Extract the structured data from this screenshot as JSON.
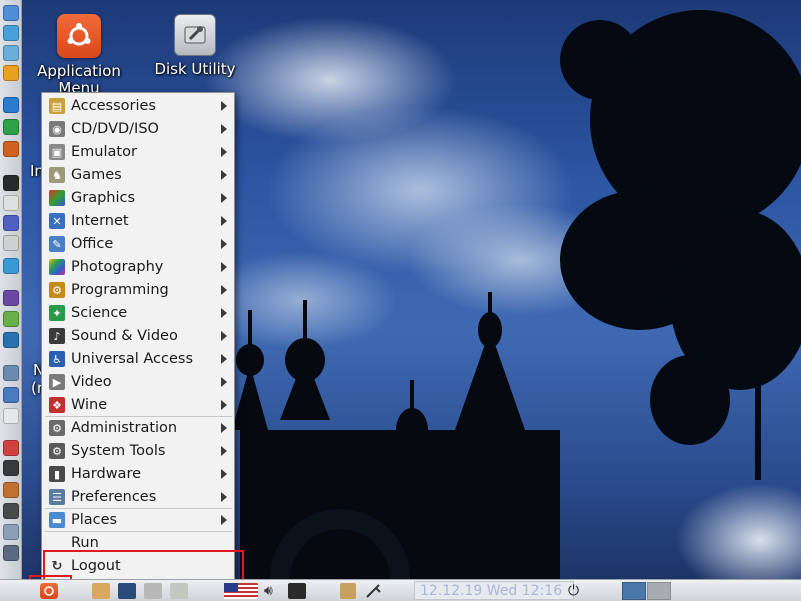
{
  "desktop": {
    "icons": [
      {
        "label": "Application Menu"
      },
      {
        "label": "Disk Utility"
      }
    ],
    "partial_labels": [
      "In",
      "N",
      "(r"
    ]
  },
  "menu": {
    "items": [
      {
        "label": "Accessories",
        "icon": "accessories-icon",
        "color": "#c9a13a",
        "submenu": true
      },
      {
        "label": "CD/DVD/ISO",
        "icon": "cd-dvd-icon",
        "color": "#7a7a7a",
        "submenu": true
      },
      {
        "label": "Emulator",
        "icon": "emulator-icon",
        "color": "#8a8a8a",
        "submenu": true
      },
      {
        "label": "Games",
        "icon": "games-icon",
        "color": "#9a9a7a",
        "submenu": true
      },
      {
        "label": "Graphics",
        "icon": "graphics-icon",
        "color": "#d04fa0",
        "submenu": true
      },
      {
        "label": "Internet",
        "icon": "internet-icon",
        "color": "#3a6fc0",
        "submenu": true
      },
      {
        "label": "Office",
        "icon": "office-icon",
        "color": "#4a7fc5",
        "submenu": true
      },
      {
        "label": "Photography",
        "icon": "photography-icon",
        "color": "#2aa05a",
        "submenu": true
      },
      {
        "label": "Programming",
        "icon": "programming-icon",
        "color": "#c48a1a",
        "submenu": true
      },
      {
        "label": "Science",
        "icon": "science-icon",
        "color": "#2a9a4a",
        "submenu": true
      },
      {
        "label": "Sound & Video",
        "icon": "sound-video-icon",
        "color": "#3a3a3a",
        "submenu": true
      },
      {
        "label": "Universal Access",
        "icon": "universal-access-icon",
        "color": "#2a5fb0",
        "submenu": true
      },
      {
        "label": "Video",
        "icon": "video-icon",
        "color": "#7a7a7a",
        "submenu": true
      },
      {
        "label": "Wine",
        "icon": "wine-icon",
        "color": "#c03030",
        "submenu": true
      },
      {
        "label": "Administration",
        "icon": "administration-icon",
        "color": "#6a6a6a",
        "submenu": true
      },
      {
        "label": "System Tools",
        "icon": "system-tools-icon",
        "color": "#5a5a5a",
        "submenu": true
      },
      {
        "label": "Hardware",
        "icon": "hardware-icon",
        "color": "#4a4a4a",
        "submenu": true
      },
      {
        "label": "Preferences",
        "icon": "preferences-icon",
        "color": "#5a7aa0",
        "submenu": true
      },
      {
        "label": "Places",
        "icon": "places-icon",
        "color": "#4a8ad0",
        "submenu": true
      },
      {
        "label": "Run",
        "icon": "",
        "color": "",
        "submenu": false
      },
      {
        "label": "Logout",
        "icon": "logout-icon",
        "color": "#3a3a3a",
        "submenu": false
      }
    ]
  },
  "panel": {
    "clock": "12.12.19 Wed 12:16"
  }
}
